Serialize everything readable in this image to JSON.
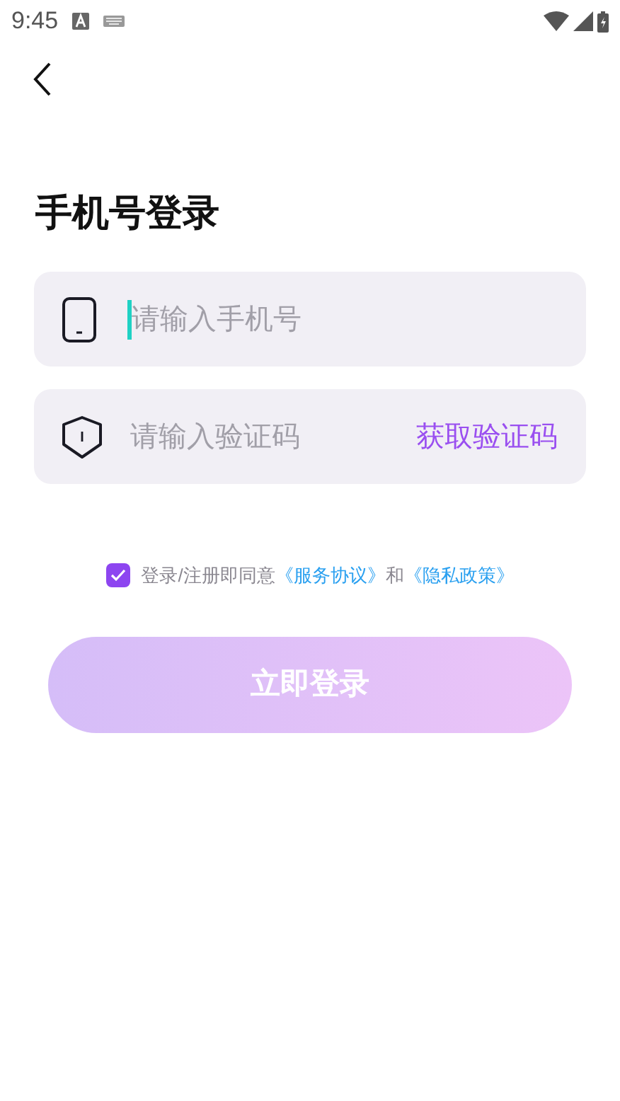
{
  "status_bar": {
    "time": "9:45"
  },
  "title": "手机号登录",
  "fields": [
    {
      "kind": "phone",
      "placeholder": "请输入手机号",
      "focused": true
    },
    {
      "kind": "code",
      "placeholder": "请输入验证码",
      "focused": false,
      "action": "获取验证码"
    }
  ],
  "agreement": {
    "checked": true,
    "text": "登录/注册即同意",
    "link_1": "《服务协议》",
    "joiner": "和",
    "link_2": "《隐私政策》"
  },
  "login_button": {
    "label": "立即登录",
    "disabled": true
  }
}
